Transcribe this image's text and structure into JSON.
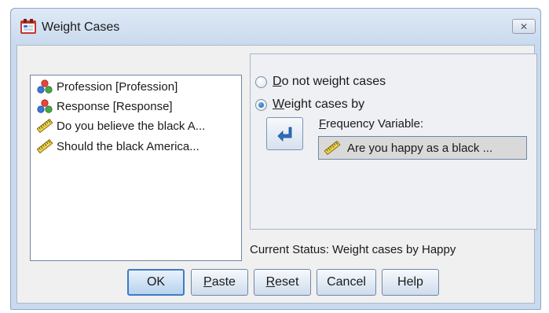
{
  "window": {
    "title": "Weight Cases",
    "close_glyph": "✕"
  },
  "variables": [
    {
      "icon": "nominal-icon",
      "label": "Profession [Profession]"
    },
    {
      "icon": "nominal-icon",
      "label": "Response [Response]"
    },
    {
      "icon": "scale-ruler-icon",
      "label": "Do you believe the black A..."
    },
    {
      "icon": "scale-ruler-icon",
      "label": "Should the black America..."
    }
  ],
  "options": {
    "no_weight": {
      "mnemonic": "D",
      "rest": "o not weight cases",
      "selected": false
    },
    "weight_by": {
      "mnemonic": "W",
      "rest": "eight cases by",
      "selected": true
    }
  },
  "frequency": {
    "label_mnemonic": "F",
    "label_rest": "requency Variable:",
    "value": "Are you happy as a black ...",
    "icon": "scale-ruler-icon"
  },
  "status": "Current Status: Weight cases by Happy",
  "buttons": {
    "ok": "OK",
    "paste_mnemonic": "P",
    "paste_rest": "aste",
    "reset_mnemonic": "R",
    "reset_rest": "eset",
    "cancel": "Cancel",
    "help": "Help"
  },
  "colors": {
    "window_frame": "#c9daee",
    "client": "#f0f0f0",
    "default_button_border": "#3f7bc4"
  }
}
